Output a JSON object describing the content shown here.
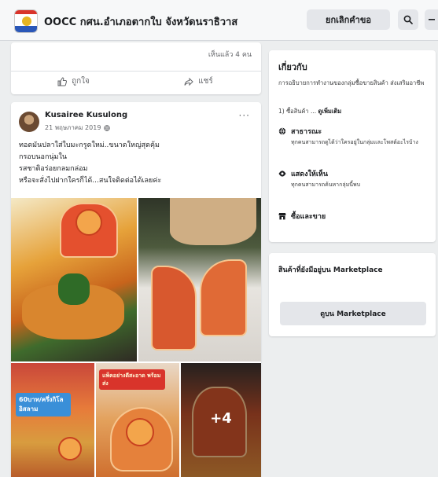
{
  "header": {
    "group_title": "OOCC กศน.อำเภอตากใบ จังหวัดนราธิวาส",
    "cancel_label": "ยกเลิกคำขอ",
    "search_icon": "search-icon",
    "more_icon": "more-icon"
  },
  "summary_card": {
    "seen_by": "เห็นแล้ว 4 คน",
    "like_label": "ถูกใจ",
    "share_label": "แชร์"
  },
  "post": {
    "author": "Kusairee Kusulong",
    "date": "21 พฤษภาคม 2019",
    "privacy_icon": "globe-icon",
    "more_label": "···",
    "lines": [
      "ทอดมันปลาใส่ใบมะกรูดใหม่..ขนาดใหญ่สุดคุ้ม",
      "กรอบนอกนุ่มใน",
      "รสชาติอร่อยกลมกล่อม",
      "หรือจะสั่งไปฝากใครก็ได้...สนใจติดต่อได้เลยค่ะ"
    ],
    "price_tag": "60บาท/ครึ่งกิโล อิสลาม",
    "promo_tag": "แพ็คอย่างดีสะอาด พร้อมส่ง",
    "more_photos": "+4"
  },
  "about": {
    "title": "เกี่ยวกับ",
    "description": "การอธิบายการทำงานของกลุ่มซื้อขายสินค้า ส่งเสริมอาชีพ",
    "more_prefix": "1) ซื้อสินค้า ... ",
    "more_link": "ดูเพิ่มเติม",
    "items": [
      {
        "icon": "globe-icon",
        "label": "สาธารณะ",
        "sub": "ทุกคนสามารถดูได้ว่าใครอยู่ในกลุ่มและโพสต์อะไรบ้าง"
      },
      {
        "icon": "eye-icon",
        "label": "แสดงให้เห็น",
        "sub": "ทุกคนสามารถค้นหากลุ่มนี้พบ"
      },
      {
        "icon": "shop-icon",
        "label": "ซื้อและขาย",
        "sub": ""
      }
    ]
  },
  "marketplace": {
    "title": "สินค้าที่ยังมีอยู่บน Marketplace",
    "button_label": "ดูบน Marketplace"
  }
}
